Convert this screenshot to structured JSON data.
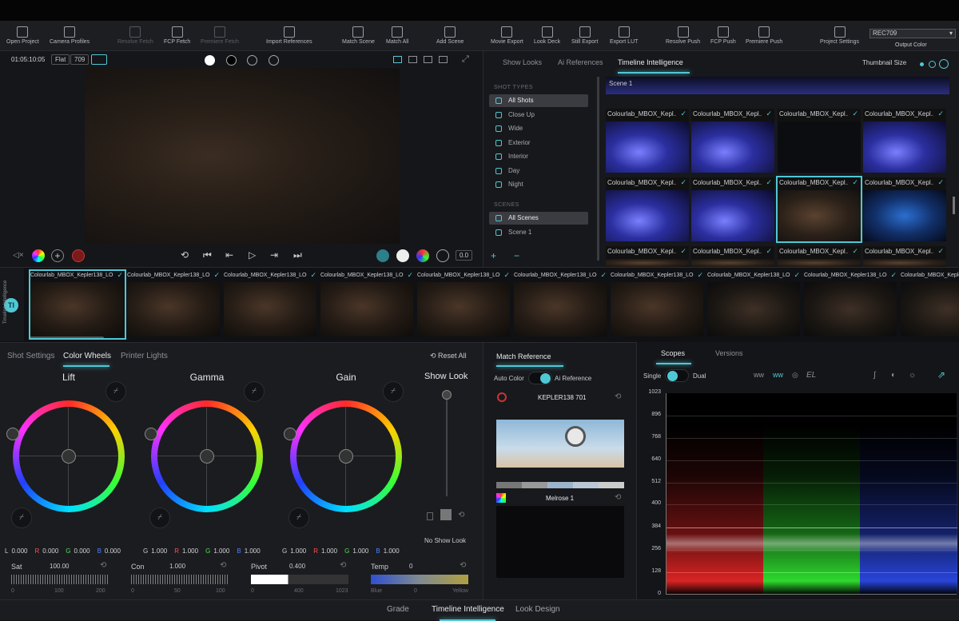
{
  "toolbar": {
    "items": [
      {
        "label": "Open Project",
        "enabled": true
      },
      {
        "label": "Camera Profiles",
        "enabled": true
      },
      {
        "label": "Resolve Fetch",
        "enabled": false
      },
      {
        "label": "FCP Fetch",
        "enabled": true
      },
      {
        "label": "Premiere Fetch",
        "enabled": false
      },
      {
        "label": "Import References",
        "enabled": true
      },
      {
        "label": "Match Scene",
        "enabled": true
      },
      {
        "label": "Match All",
        "enabled": true
      },
      {
        "label": "Add Scene",
        "enabled": true
      },
      {
        "label": "Movie Export",
        "enabled": true
      },
      {
        "label": "Look Deck",
        "enabled": true
      },
      {
        "label": "Still Export",
        "enabled": true
      },
      {
        "label": "Export LUT",
        "enabled": true
      },
      {
        "label": "Resolve Push",
        "enabled": true
      },
      {
        "label": "FCP Push",
        "enabled": true
      },
      {
        "label": "Premiere Push",
        "enabled": true
      },
      {
        "label": "Project Settings",
        "enabled": true
      }
    ],
    "output_color_value": "REC709",
    "output_color_label": "Output Color"
  },
  "viewer": {
    "timecode": "01:05:10:05",
    "flat_label": "Flat",
    "rec_label": "709",
    "gain_readout": "0.0"
  },
  "ti": {
    "tabs": [
      "Show Looks",
      "Ai References",
      "Timeline Intelligence"
    ],
    "active_tab": "Timeline Intelligence",
    "thumbnail_size_label": "Thumbnail Size",
    "shot_types_heading": "SHOT TYPES",
    "shot_types": [
      "All Shots",
      "Close Up",
      "Wide",
      "Exterior",
      "Interior",
      "Day",
      "Night"
    ],
    "scenes_heading": "SCENES",
    "scenes": [
      "All Scenes",
      "Scene 1"
    ],
    "add_label": "+",
    "remove_label": "−",
    "scene_header": "Scene 1",
    "grid_rows": [
      [
        {
          "label": "Colourlab_MBOX_Kepl...",
          "kind": "storm"
        },
        {
          "label": "Colourlab_MBOX_Kepl...",
          "kind": "storm"
        },
        {
          "label": "Colourlab_MBOX_Kepl...",
          "kind": "dark"
        },
        {
          "label": "Colourlab_MBOX_Kepl...",
          "kind": "storm"
        }
      ],
      [
        {
          "label": "Colourlab_MBOX_Kepl...",
          "kind": "storm"
        },
        {
          "label": "Colourlab_MBOX_Kepl...",
          "kind": "storm"
        },
        {
          "label": "Colourlab_MBOX_Kepl...",
          "kind": "face"
        },
        {
          "label": "Colourlab_MBOX_Kepl...",
          "kind": "blue"
        }
      ],
      [
        {
          "label": "Colourlab_MBOX_Kepl...",
          "kind": "face"
        },
        {
          "label": "Colourlab_MBOX_Kepl...",
          "kind": "face"
        },
        {
          "label": "Colourlab_MBOX_Kepl...",
          "kind": "face"
        },
        {
          "label": "Colourlab_MBOX_Kepl...",
          "kind": "face"
        }
      ]
    ]
  },
  "filmstrip": {
    "side_label": "Timeline Intelligence",
    "clips": [
      "Colourlab_MBOX_Kepler138_LOG...",
      "Colourlab_MBOX_Kepler138_LOG...",
      "Colourlab_MBOX_Kepler138_LOG...",
      "Colourlab_MBOX_Kepler138_LOG...",
      "Colourlab_MBOX_Kepler138_LOG...",
      "Colourlab_MBOX_Kepler138_LOG...",
      "Colourlab_MBOX_Kepler138_LOG...",
      "Colourlab_MBOX_Kepler138_LOG...",
      "Colourlab_MBOX_Kepler138_LOG...",
      "Colourlab_MBOX_Kepler138_LOG..."
    ]
  },
  "grade": {
    "tabs": [
      "Shot Settings",
      "Color Wheels",
      "Printer Lights"
    ],
    "active_tab": "Color Wheels",
    "reset_all": "Reset All",
    "wheels": [
      {
        "name": "Lift",
        "values": [
          {
            "ch": "L",
            "v": "0.000"
          },
          {
            "ch": "R",
            "v": "0.000"
          },
          {
            "ch": "G",
            "v": "0.000"
          },
          {
            "ch": "B",
            "v": "0.000"
          }
        ]
      },
      {
        "name": "Gamma",
        "values": [
          {
            "ch": "G",
            "v": "1.000"
          },
          {
            "ch": "R",
            "v": "1.000"
          },
          {
            "ch": "G",
            "v": "1.000"
          },
          {
            "ch": "B",
            "v": "1.000"
          }
        ]
      },
      {
        "name": "Gain",
        "values": [
          {
            "ch": "G",
            "v": "1.000"
          },
          {
            "ch": "R",
            "v": "1.000"
          },
          {
            "ch": "G",
            "v": "1.000"
          },
          {
            "ch": "B",
            "v": "1.000"
          }
        ]
      }
    ],
    "show_look": "Show Look",
    "no_show_look": "No Show Look",
    "sliders": [
      {
        "name": "Sat",
        "value": "100.00",
        "ticks": [
          "0",
          "100",
          "200"
        ]
      },
      {
        "name": "Con",
        "value": "1.000",
        "ticks": [
          "0",
          "50",
          "100"
        ]
      },
      {
        "name": "Pivot",
        "value": "0.400",
        "ticks": [
          "0",
          "400",
          "1023"
        ]
      },
      {
        "name": "Temp",
        "value": "0",
        "ticks": [
          "Blue",
          "0",
          "Yellow"
        ]
      }
    ]
  },
  "match": {
    "title": "Match Reference",
    "auto_color": "Auto Color",
    "ai_reference": "Ai Reference",
    "ref_name": "KEPLER138 701",
    "look_name": "Melrose 1"
  },
  "scopes": {
    "tabs": [
      "Scopes",
      "Versions"
    ],
    "active_tab": "Scopes",
    "single": "Single",
    "dual": "Dual",
    "el": "EL",
    "y_ticks": [
      "1023",
      "896",
      "768",
      "640",
      "512",
      "400",
      "384",
      "256",
      "128",
      "0"
    ]
  },
  "bottom_tabs": [
    "Grade",
    "Timeline Intelligence",
    "Look Design"
  ],
  "active_bottom_tab": "Timeline Intelligence",
  "colors": {
    "accent": "#4fc8d6"
  }
}
